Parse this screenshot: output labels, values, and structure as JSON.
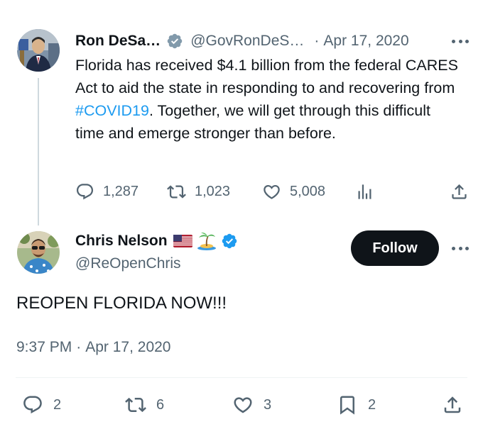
{
  "parent_tweet": {
    "author_name": "Ron DeSa…",
    "handle": "@GovRonDeS…",
    "separator": "·",
    "date": "Apr 17, 2020",
    "text_before": "Florida has received $4.1 billion from the federal CARES Act to aid the state in responding to and recovering from ",
    "hashtag": "#COVID19",
    "text_after": ". Together, we will get through this difficult time and emerge stronger than before.",
    "replies": "1,287",
    "retweets": "1,023",
    "likes": "5,008",
    "verified_color": "#829aab"
  },
  "main_tweet": {
    "author_name": "Chris Nelson",
    "emojis": "🇺🇸 🏝️",
    "handle": "@ReOpenChris",
    "follow_label": "Follow",
    "text": "REOPEN FLORIDA NOW!!!",
    "time": "9:37 PM",
    "separator": "·",
    "date": "Apr 17, 2020",
    "replies": "2",
    "retweets": "6",
    "likes": "3",
    "bookmarks": "2",
    "verified_color": "#1d9bf0"
  },
  "colors": {
    "text": "#0f1419",
    "muted": "#536471",
    "link": "#1d9bf0",
    "follow_bg": "#0f1419",
    "line": "#cfd9de"
  },
  "icons": [
    "reply-icon",
    "retweet-icon",
    "like-icon",
    "views-icon",
    "share-icon",
    "bookmark-icon",
    "verified-badge-icon",
    "more-icon"
  ]
}
